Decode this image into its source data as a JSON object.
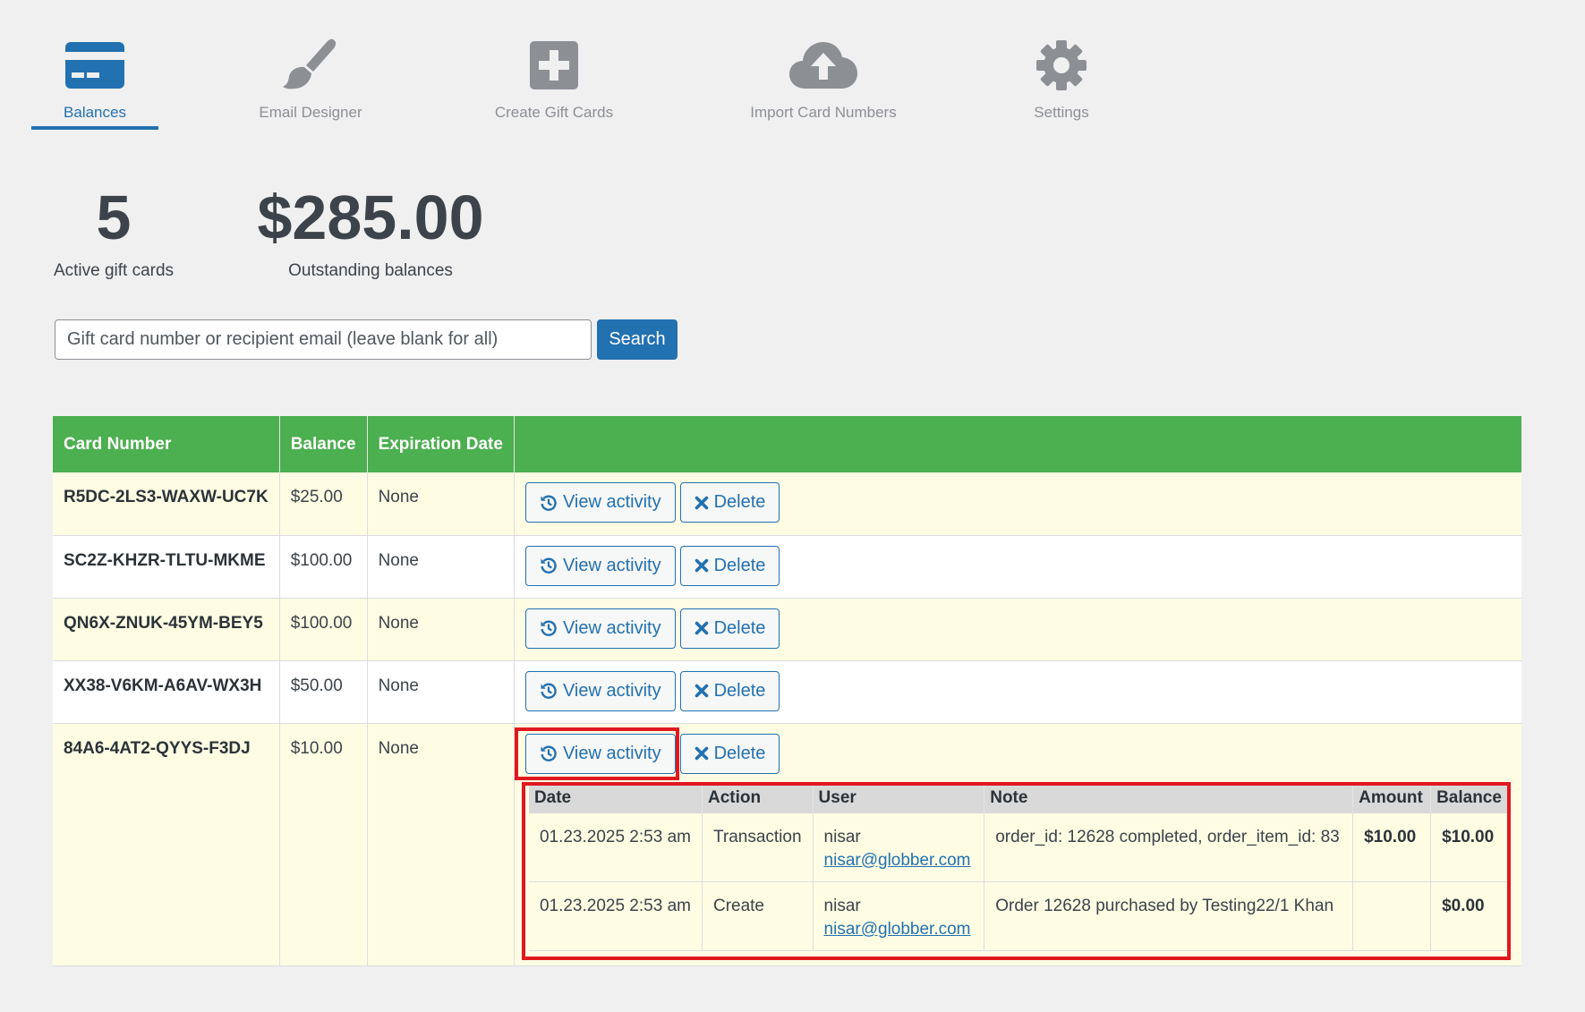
{
  "tabs": [
    {
      "label": "Balances",
      "icon": "credit-card-icon",
      "active": true
    },
    {
      "label": "Email Designer",
      "icon": "paintbrush-icon",
      "active": false
    },
    {
      "label": "Create Gift Cards",
      "icon": "plus-square-icon",
      "active": false
    },
    {
      "label": "Import Card Numbers",
      "icon": "cloud-upload-icon",
      "active": false
    },
    {
      "label": "Settings",
      "icon": "gear-icon",
      "active": false
    }
  ],
  "stats": {
    "active_count": "5",
    "active_label": "Active gift cards",
    "outstanding_amount": "$285.00",
    "outstanding_label": "Outstanding balances"
  },
  "search": {
    "placeholder": "Gift card number or recipient email (leave blank for all)",
    "value": "",
    "button_label": "Search"
  },
  "colors": {
    "accent": "#2271b1",
    "header_green": "#4caf50",
    "highlight_red": "#e0191f",
    "row_yellow": "#fefde4"
  },
  "table": {
    "headers": [
      "Card Number",
      "Balance",
      "Expiration Date",
      ""
    ],
    "view_label": "View activity",
    "delete_label": "Delete",
    "rows": [
      {
        "number": "R5DC-2LS3-WAXW-UC7K",
        "balance": "$25.00",
        "expiration": "None"
      },
      {
        "number": "SC2Z-KHZR-TLTU-MKME",
        "balance": "$100.00",
        "expiration": "None"
      },
      {
        "number": "QN6X-ZNUK-45YM-BEY5",
        "balance": "$100.00",
        "expiration": "None"
      },
      {
        "number": "XX38-V6KM-A6AV-WX3H",
        "balance": "$50.00",
        "expiration": "None"
      },
      {
        "number": "84A6-4AT2-QYYS-F3DJ",
        "balance": "$10.00",
        "expiration": "None"
      }
    ]
  },
  "activity": {
    "headers": [
      "Date",
      "Action",
      "User",
      "Note",
      "Amount",
      "Balance"
    ],
    "rows": [
      {
        "date": "01.23.2025 2:53 am",
        "action": "Transaction",
        "user": "nisar",
        "email": "nisar@globber.com",
        "note": "order_id: 12628 completed, order_item_id: 83",
        "amount": "$10.00",
        "balance": "$10.00"
      },
      {
        "date": "01.23.2025 2:53 am",
        "action": "Create",
        "user": "nisar",
        "email": "nisar@globber.com",
        "note": "Order 12628 purchased by Testing22/1 Khan",
        "amount": "",
        "balance": "$0.00"
      }
    ]
  }
}
